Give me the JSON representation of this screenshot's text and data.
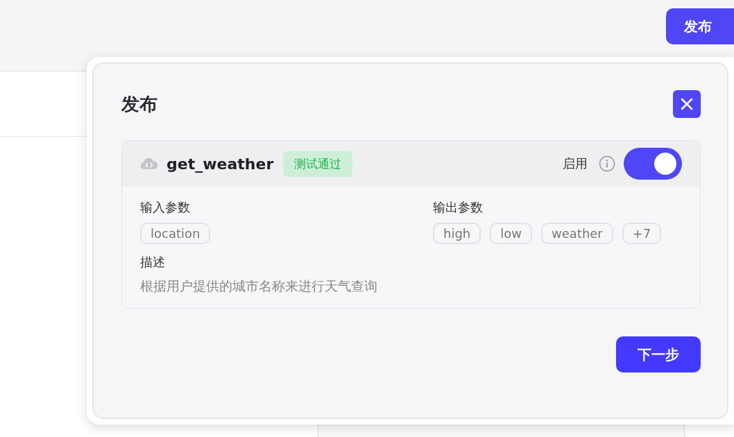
{
  "header": {
    "publish_button": "发布"
  },
  "dialog": {
    "title": "发布",
    "tool": {
      "name": "get_weather",
      "status": "测试通过",
      "enable_label": "启用",
      "enabled": true,
      "input_label": "输入参数",
      "inputs": [
        "location"
      ],
      "output_label": "输出参数",
      "outputs": [
        "high",
        "low",
        "weather",
        "+7"
      ],
      "description_label": "描述",
      "description": "根据用户提供的城市名称来进行天气查询"
    },
    "next_button": "下一步"
  }
}
